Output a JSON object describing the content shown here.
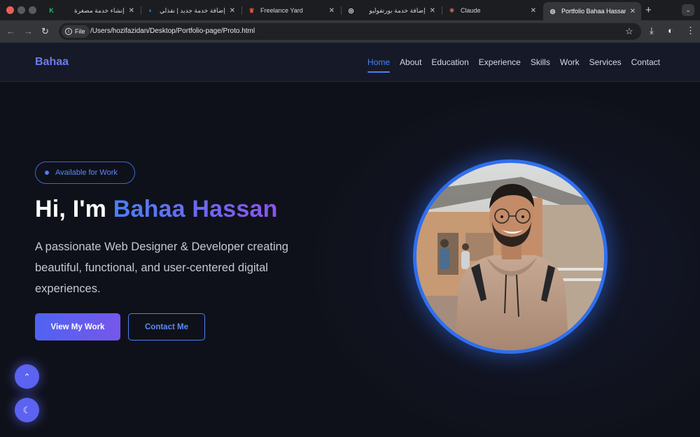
{
  "browser": {
    "tabs": [
      {
        "label": "إنشاء خدمة مصغرة",
        "favicon": "K",
        "favicon_color": "#23c46b"
      },
      {
        "label": "إضافة خدمة جديد | نفذلي",
        "favicon": "◐",
        "favicon_color": "#2f8cf0"
      },
      {
        "label": "Freelance Yard",
        "favicon": "♛",
        "favicon_color": "#e0553f"
      },
      {
        "label": "إضافة خدمة بورتفوليو",
        "favicon": "◎",
        "favicon_color": "#e8e9eb"
      },
      {
        "label": "Claude",
        "favicon": "✳",
        "favicon_color": "#d97757"
      },
      {
        "label": "Portfolio Bahaa Hassan",
        "favicon": "◍",
        "favicon_color": "#c9cace"
      }
    ],
    "file_chip": "File",
    "url": "/Users/hozifazidan/Desktop/Portfolio-page/Proto.html"
  },
  "site": {
    "logo": "Bahaa",
    "nav": [
      "Home",
      "About",
      "Education",
      "Experience",
      "Skills",
      "Work",
      "Services",
      "Contact"
    ],
    "badge": "Available for Work",
    "title_prefix": "Hi, I'm ",
    "title_name": "Bahaa Hassan",
    "subtitle": "A passionate Web Designer & Developer creating beautiful, functional, and user-centered digital experiences.",
    "primary_button": "View My Work",
    "secondary_button": "Contact Me"
  },
  "colors": {
    "accent": "#4d7ff5",
    "gradient_start": "#4a80f5",
    "gradient_end": "#8a55ec",
    "background": "#0f111a"
  }
}
